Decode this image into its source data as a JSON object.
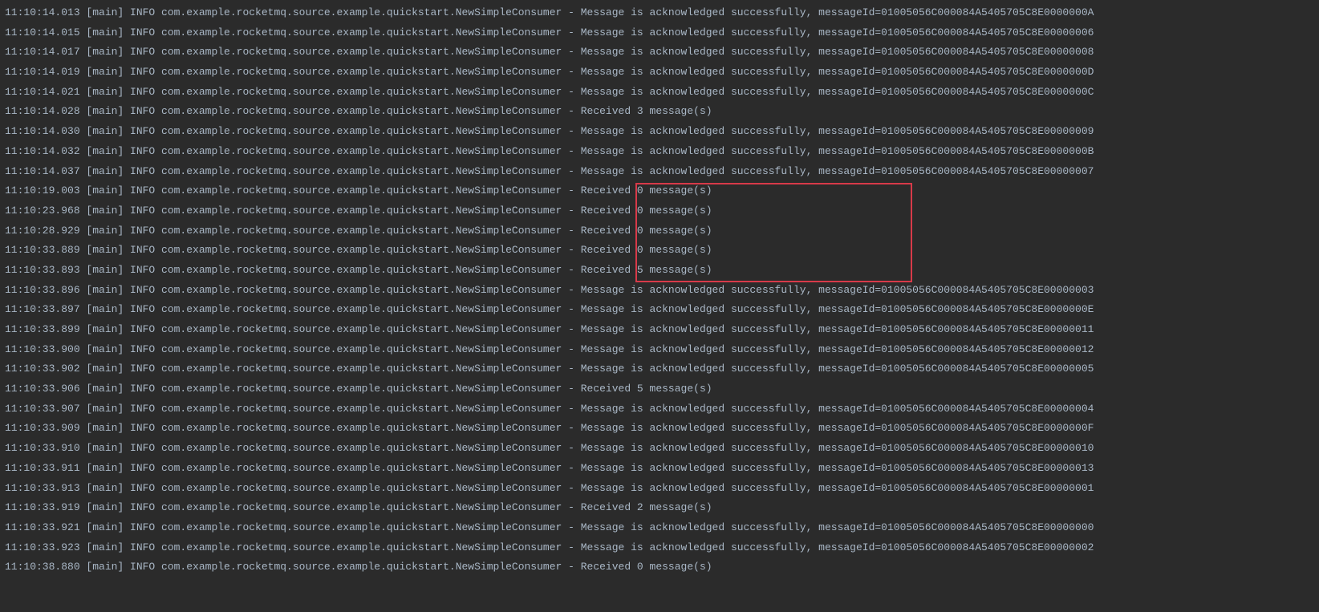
{
  "common": {
    "thread": "[main]",
    "level": "INFO",
    "logger": "com.example.rocketmq.source.example.quickstart.NewSimpleConsumer",
    "separator": " - ",
    "ackPrefix": "Message is acknowledged successfully, messageId=",
    "recvPrefix": "Received ",
    "recvSuffix": " message(s)",
    "msgIdBase": "01005056C000084A5405705C8E0000000"
  },
  "lines": [
    {
      "ts": "11:10:14.013",
      "type": "ack",
      "suffix": "A"
    },
    {
      "ts": "11:10:14.015",
      "type": "ack",
      "suffix": "6"
    },
    {
      "ts": "11:10:14.017",
      "type": "ack",
      "suffix": "8"
    },
    {
      "ts": "11:10:14.019",
      "type": "ack",
      "suffix": "D"
    },
    {
      "ts": "11:10:14.021",
      "type": "ack",
      "suffix": "C"
    },
    {
      "ts": "11:10:14.028",
      "type": "recv",
      "count": 3
    },
    {
      "ts": "11:10:14.030",
      "type": "ack",
      "suffix": "9"
    },
    {
      "ts": "11:10:14.032",
      "type": "ack",
      "suffix": "B"
    },
    {
      "ts": "11:10:14.037",
      "type": "ack",
      "suffix": "7"
    },
    {
      "ts": "11:10:19.003",
      "type": "recv",
      "count": 0
    },
    {
      "ts": "11:10:23.968",
      "type": "recv",
      "count": 0
    },
    {
      "ts": "11:10:28.929",
      "type": "recv",
      "count": 0
    },
    {
      "ts": "11:10:33.889",
      "type": "recv",
      "count": 0
    },
    {
      "ts": "11:10:33.893",
      "type": "recv",
      "count": 5
    },
    {
      "ts": "11:10:33.896",
      "type": "ack",
      "suffix": "3"
    },
    {
      "ts": "11:10:33.897",
      "type": "ack",
      "suffix": "E"
    },
    {
      "ts": "11:10:33.899",
      "type": "ack",
      "suffix2": "11"
    },
    {
      "ts": "11:10:33.900",
      "type": "ack",
      "suffix2": "12"
    },
    {
      "ts": "11:10:33.902",
      "type": "ack",
      "suffix": "5"
    },
    {
      "ts": "11:10:33.906",
      "type": "recv",
      "count": 5
    },
    {
      "ts": "11:10:33.907",
      "type": "ack",
      "suffix": "4"
    },
    {
      "ts": "11:10:33.909",
      "type": "ack",
      "suffix": "F"
    },
    {
      "ts": "11:10:33.910",
      "type": "ack",
      "suffix2": "10"
    },
    {
      "ts": "11:10:33.911",
      "type": "ack",
      "suffix2": "13"
    },
    {
      "ts": "11:10:33.913",
      "type": "ack",
      "suffix": "1"
    },
    {
      "ts": "11:10:33.919",
      "type": "recv",
      "count": 2
    },
    {
      "ts": "11:10:33.921",
      "type": "ack",
      "suffix": "0"
    },
    {
      "ts": "11:10:33.923",
      "type": "ack",
      "suffix": "2"
    },
    {
      "ts": "11:10:38.880",
      "type": "recv",
      "count": 0
    }
  ],
  "highlight": {
    "startIndex": 9,
    "endIndex": 13
  }
}
